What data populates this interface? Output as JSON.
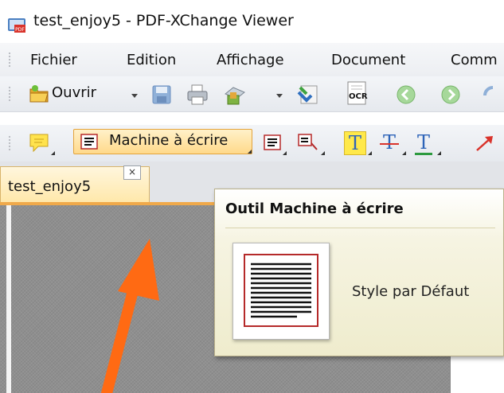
{
  "window": {
    "title": "test_enjoy5 - PDF-XChange Viewer"
  },
  "menu": {
    "items": [
      "Fichier",
      "Edition",
      "Affichage",
      "Document",
      "Comm"
    ]
  },
  "toolbar1": {
    "open_label": "Ouvrir",
    "ocr_label": "OCR"
  },
  "toolbar2": {
    "typewriter_label": "Machine à écrire",
    "text_tool_letter": "T"
  },
  "tabs": {
    "doc_tab_label": "test_enjoy5",
    "close_glyph": "×"
  },
  "tooltip": {
    "title": "Outil Machine à écrire",
    "style_label": "Style par Défaut"
  },
  "colors": {
    "accent_orange": "#ff6a13",
    "tab_highlight": "#ffd98a",
    "tooltip_bg": "#efeccd"
  }
}
